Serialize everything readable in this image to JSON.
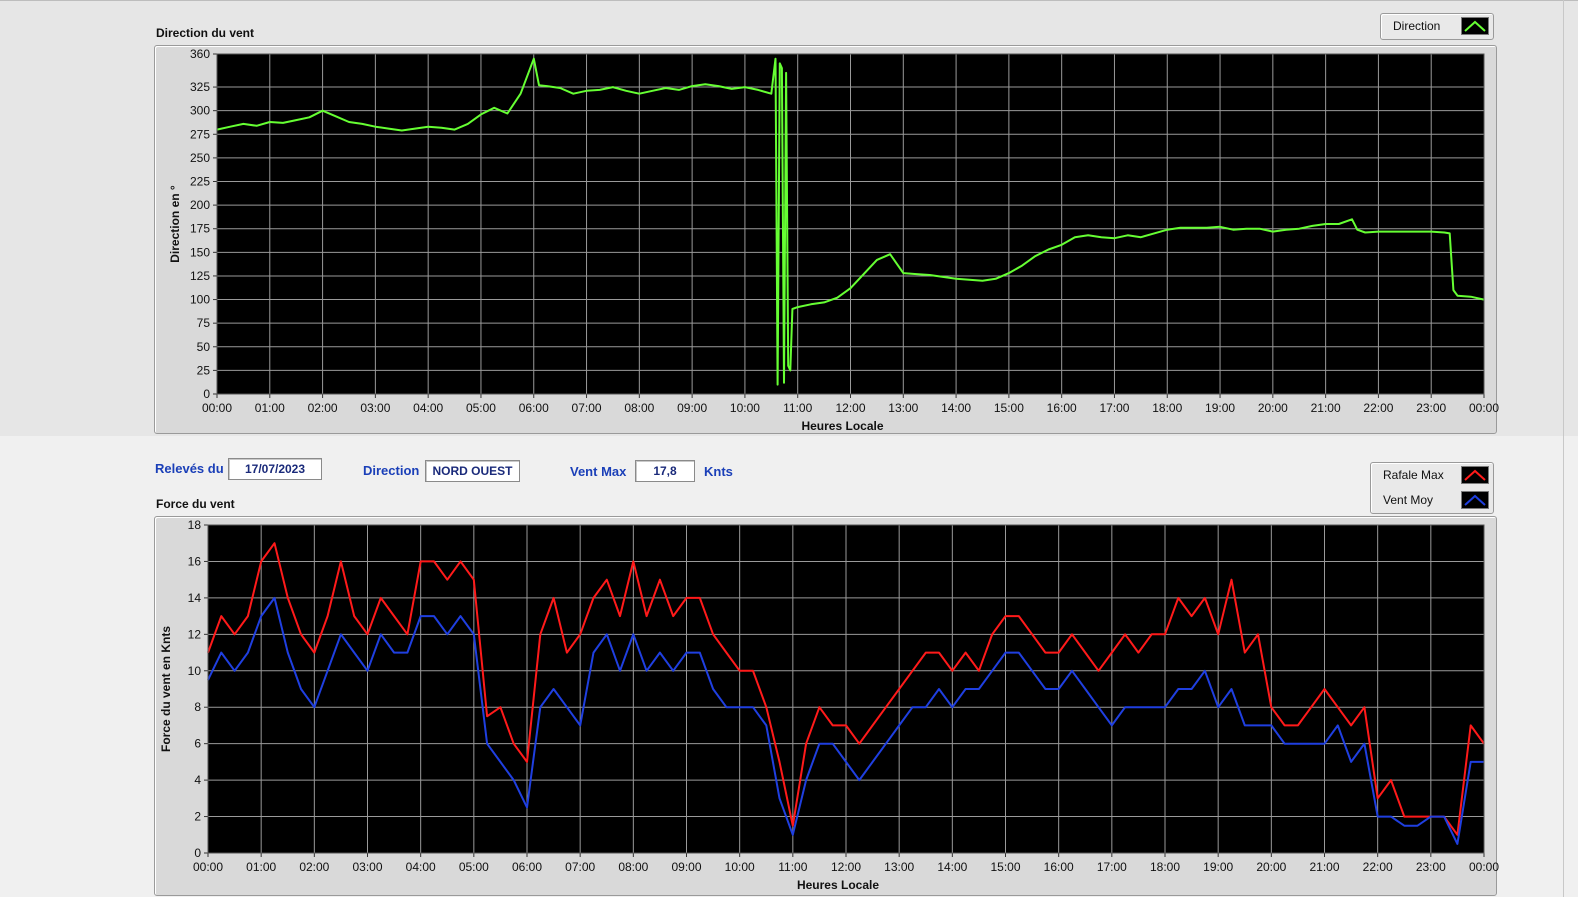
{
  "direction_panel": {
    "section_title": "Direction du vent",
    "legend_label": "Direction",
    "line_color": "#66ff33"
  },
  "force_panel": {
    "section_title": "Force du vent",
    "legend": [
      {
        "label": "Rafale Max",
        "color": "#ff1a1a"
      },
      {
        "label": "Vent Moy",
        "color": "#1f3fe0"
      }
    ]
  },
  "controls": {
    "releves_label": "Relevés du",
    "date_value": "17/07/2023",
    "direction_label": "Direction",
    "direction_value": "NORD OUEST",
    "ventmax_label": "Vent Max",
    "ventmax_value": "17,8",
    "unit_label": "Knts"
  },
  "chart_data": [
    {
      "type": "line",
      "xlabel": "Heures Locale",
      "ylabel": "Direction en °",
      "ylim": [
        0,
        360
      ],
      "yticks": [
        0,
        25,
        50,
        75,
        100,
        125,
        150,
        175,
        200,
        225,
        250,
        275,
        300,
        325,
        360
      ],
      "x_tick_labels": [
        "00:00",
        "01:00",
        "02:00",
        "03:00",
        "04:00",
        "05:00",
        "06:00",
        "07:00",
        "08:00",
        "09:00",
        "10:00",
        "11:00",
        "12:00",
        "13:00",
        "14:00",
        "15:00",
        "16:00",
        "17:00",
        "18:00",
        "19:00",
        "20:00",
        "21:00",
        "22:00",
        "23:00",
        "00:00"
      ],
      "xlim_hours": [
        0,
        24
      ],
      "grid": true,
      "legend_position": "top-right",
      "series": [
        {
          "name": "Direction",
          "x_hours": [
            0,
            0.25,
            0.5,
            0.75,
            1,
            1.25,
            1.5,
            1.75,
            2,
            2.25,
            2.5,
            2.75,
            3,
            3.25,
            3.5,
            3.75,
            4,
            4.25,
            4.5,
            4.75,
            5,
            5.25,
            5.5,
            5.75,
            6,
            6.1,
            6.25,
            6.5,
            6.75,
            7,
            7.25,
            7.5,
            7.75,
            8,
            8.25,
            8.5,
            8.75,
            9,
            9.25,
            9.5,
            9.75,
            10,
            10.25,
            10.5,
            10.58,
            10.62,
            10.66,
            10.7,
            10.74,
            10.78,
            10.82,
            10.86,
            10.9,
            11,
            11.25,
            11.5,
            11.75,
            12,
            12.25,
            12.5,
            12.75,
            13,
            13.25,
            13.5,
            13.75,
            14,
            14.25,
            14.5,
            14.75,
            15,
            15.25,
            15.5,
            15.75,
            16,
            16.25,
            16.5,
            16.75,
            17,
            17.25,
            17.5,
            17.75,
            18,
            18.25,
            18.5,
            18.75,
            19,
            19.25,
            19.5,
            19.75,
            20,
            20.25,
            20.5,
            20.75,
            21,
            21.25,
            21.5,
            21.6,
            21.75,
            22,
            22.25,
            22.5,
            22.75,
            23,
            23.25,
            23.35,
            23.42,
            23.5,
            23.75,
            24
          ],
          "values": [
            280,
            283,
            286,
            284,
            288,
            287,
            290,
            293,
            300,
            294,
            288,
            286,
            283,
            281,
            279,
            281,
            283,
            282,
            280,
            286,
            296,
            303,
            297,
            318,
            355,
            327,
            326,
            324,
            318,
            321,
            322,
            325,
            321,
            318,
            321,
            324,
            322,
            326,
            328,
            326,
            323,
            325,
            322,
            318,
            355,
            10,
            350,
            345,
            12,
            340,
            30,
            25,
            90,
            92,
            95,
            97,
            102,
            112,
            127,
            142,
            148,
            128,
            127,
            126,
            124,
            122,
            121,
            120,
            122,
            128,
            136,
            146,
            153,
            158,
            166,
            168,
            166,
            165,
            168,
            166,
            170,
            174,
            176,
            176,
            176,
            177,
            174,
            175,
            175,
            172,
            174,
            175,
            178,
            180,
            180,
            185,
            174,
            171,
            172,
            172,
            172,
            172,
            172,
            171,
            170,
            110,
            104,
            103,
            100,
            97
          ]
        }
      ]
    },
    {
      "type": "line",
      "xlabel": "Heures Locale",
      "ylabel": "Force du vent en Knts",
      "ylim": [
        0,
        18
      ],
      "yticks": [
        0,
        2,
        4,
        6,
        8,
        10,
        12,
        14,
        16,
        18
      ],
      "x_tick_labels": [
        "00:00",
        "01:00",
        "02:00",
        "03:00",
        "04:00",
        "05:00",
        "06:00",
        "07:00",
        "08:00",
        "09:00",
        "10:00",
        "11:00",
        "12:00",
        "13:00",
        "14:00",
        "15:00",
        "16:00",
        "17:00",
        "18:00",
        "19:00",
        "20:00",
        "21:00",
        "22:00",
        "23:00",
        "00:00"
      ],
      "xlim_hours": [
        0,
        24
      ],
      "grid": true,
      "legend_position": "top-right",
      "series": [
        {
          "name": "Rafale Max",
          "x_hours": [
            0,
            0.25,
            0.5,
            0.75,
            1,
            1.25,
            1.5,
            1.75,
            2,
            2.25,
            2.5,
            2.75,
            3,
            3.25,
            3.5,
            3.75,
            4,
            4.25,
            4.5,
            4.75,
            5,
            5.25,
            5.5,
            5.75,
            6,
            6.25,
            6.5,
            6.75,
            7,
            7.25,
            7.5,
            7.75,
            8,
            8.25,
            8.5,
            8.75,
            9,
            9.25,
            9.5,
            9.75,
            10,
            10.25,
            10.5,
            10.75,
            11,
            11.25,
            11.5,
            11.75,
            12,
            12.25,
            12.5,
            12.75,
            13,
            13.25,
            13.5,
            13.75,
            14,
            14.25,
            14.5,
            14.75,
            15,
            15.25,
            15.5,
            15.75,
            16,
            16.25,
            16.5,
            16.75,
            17,
            17.25,
            17.5,
            17.75,
            18,
            18.25,
            18.5,
            18.75,
            19,
            19.25,
            19.5,
            19.75,
            20,
            20.25,
            20.5,
            20.75,
            21,
            21.25,
            21.5,
            21.75,
            22,
            22.25,
            22.5,
            22.75,
            23,
            23.25,
            23.5,
            23.75,
            24
          ],
          "values": [
            11,
            13,
            12,
            13,
            16,
            17,
            14,
            12,
            11,
            13,
            16,
            13,
            12,
            14,
            13,
            12,
            16,
            16,
            15,
            16,
            15,
            7.5,
            8,
            6,
            5,
            12,
            14,
            11,
            12,
            14,
            15,
            13,
            16,
            13,
            15,
            13,
            14,
            14,
            12,
            11,
            10,
            10,
            8,
            5,
            1.5,
            6,
            8,
            7,
            7,
            6,
            7,
            8,
            9,
            10,
            11,
            11,
            10,
            11,
            10,
            12,
            13,
            13,
            12,
            11,
            11,
            12,
            11,
            10,
            11,
            12,
            11,
            12,
            12,
            14,
            13,
            14,
            12,
            15,
            11,
            12,
            8,
            7,
            7,
            8,
            9,
            8,
            7,
            8,
            3,
            4,
            2,
            2,
            2,
            2,
            1,
            7,
            6,
            6
          ]
        },
        {
          "name": "Vent Moy",
          "x_hours": [
            0,
            0.25,
            0.5,
            0.75,
            1,
            1.25,
            1.5,
            1.75,
            2,
            2.25,
            2.5,
            2.75,
            3,
            3.25,
            3.5,
            3.75,
            4,
            4.25,
            4.5,
            4.75,
            5,
            5.25,
            5.5,
            5.75,
            6,
            6.25,
            6.5,
            6.75,
            7,
            7.25,
            7.5,
            7.75,
            8,
            8.25,
            8.5,
            8.75,
            9,
            9.25,
            9.5,
            9.75,
            10,
            10.25,
            10.5,
            10.75,
            11,
            11.25,
            11.5,
            11.75,
            12,
            12.25,
            12.5,
            12.75,
            13,
            13.25,
            13.5,
            13.75,
            14,
            14.25,
            14.5,
            14.75,
            15,
            15.25,
            15.5,
            15.75,
            16,
            16.25,
            16.5,
            16.75,
            17,
            17.25,
            17.5,
            17.75,
            18,
            18.25,
            18.5,
            18.75,
            19,
            19.25,
            19.5,
            19.75,
            20,
            20.25,
            20.5,
            20.75,
            21,
            21.25,
            21.5,
            21.75,
            22,
            22.25,
            22.5,
            22.75,
            23,
            23.25,
            23.5,
            23.75,
            24
          ],
          "values": [
            9.5,
            11,
            10,
            11,
            13,
            14,
            11,
            9,
            8,
            10,
            12,
            11,
            10,
            12,
            11,
            11,
            13,
            13,
            12,
            13,
            12,
            6,
            5,
            4,
            2.5,
            8,
            9,
            8,
            7,
            11,
            12,
            10,
            12,
            10,
            11,
            10,
            11,
            11,
            9,
            8,
            8,
            8,
            7,
            3,
            1,
            4,
            6,
            6,
            5,
            4,
            5,
            6,
            7,
            8,
            8,
            9,
            8,
            9,
            9,
            10,
            11,
            11,
            10,
            9,
            9,
            10,
            9,
            8,
            7,
            8,
            8,
            8,
            8,
            9,
            9,
            10,
            8,
            9,
            7,
            7,
            7,
            6,
            6,
            6,
            6,
            7,
            5,
            6,
            2,
            2,
            1.5,
            1.5,
            2,
            2,
            0.5,
            5,
            5,
            5.5
          ]
        }
      ]
    }
  ]
}
